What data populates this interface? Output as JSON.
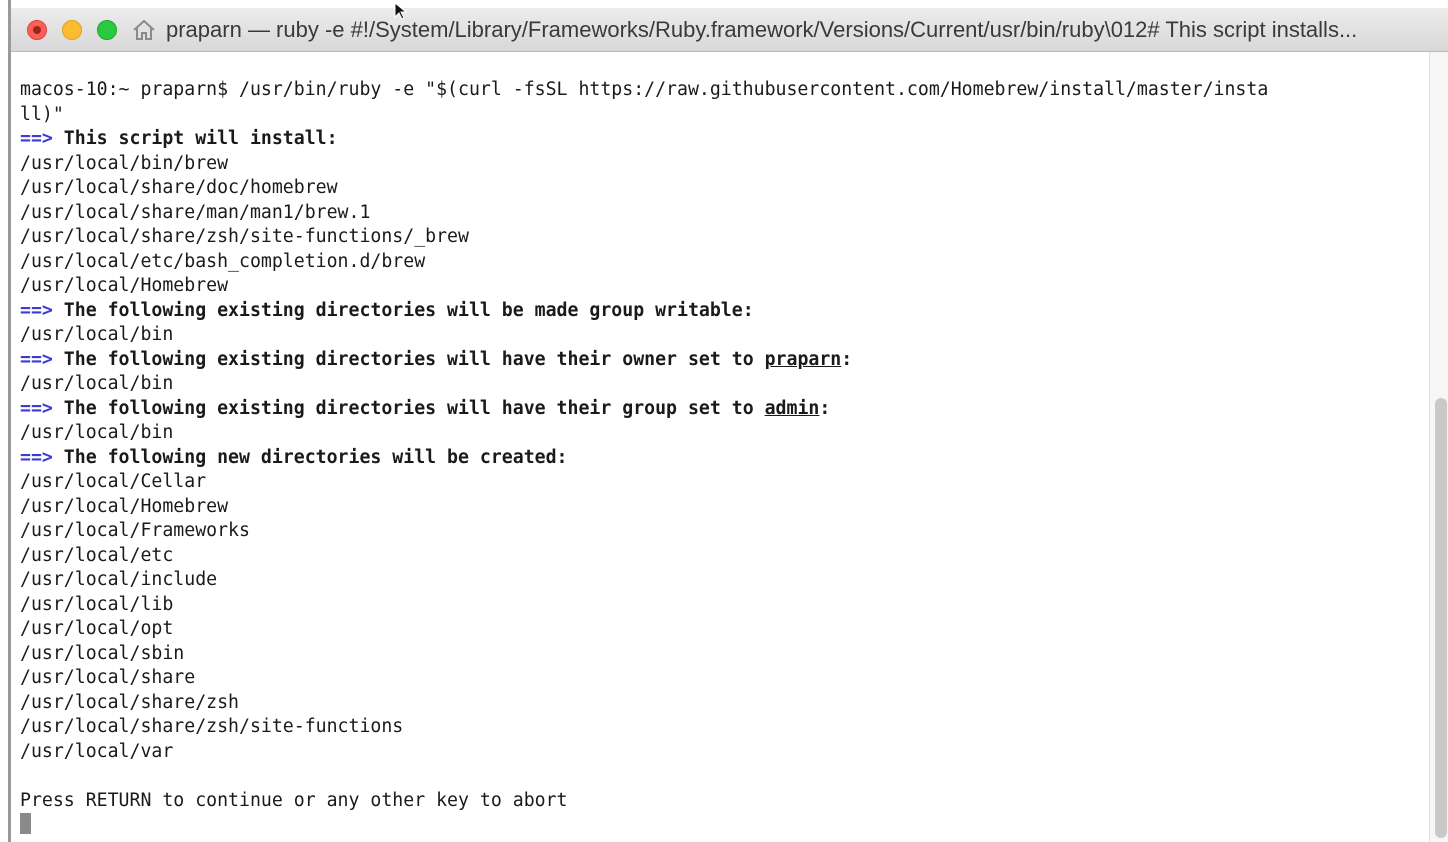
{
  "window": {
    "title": "praparn — ruby -e #!/System/Library/Frameworks/Ruby.framework/Versions/Current/usr/bin/ruby\\012# This script installs..."
  },
  "terminal": {
    "lines": [
      {
        "parts": [
          {
            "text": "macos-10:~ praparn$ /usr/bin/ruby -e \"$(curl -fsSL https://raw.githubusercontent.com/Homebrew/install/master/insta",
            "style": "plain"
          }
        ]
      },
      {
        "parts": [
          {
            "text": "ll)\"",
            "style": "plain"
          }
        ]
      },
      {
        "parts": [
          {
            "text": "==>",
            "style": "arrow"
          },
          {
            "text": " This script will install:",
            "style": "bold"
          }
        ]
      },
      {
        "parts": [
          {
            "text": "/usr/local/bin/brew",
            "style": "plain"
          }
        ]
      },
      {
        "parts": [
          {
            "text": "/usr/local/share/doc/homebrew",
            "style": "plain"
          }
        ]
      },
      {
        "parts": [
          {
            "text": "/usr/local/share/man/man1/brew.1",
            "style": "plain"
          }
        ]
      },
      {
        "parts": [
          {
            "text": "/usr/local/share/zsh/site-functions/_brew",
            "style": "plain"
          }
        ]
      },
      {
        "parts": [
          {
            "text": "/usr/local/etc/bash_completion.d/brew",
            "style": "plain"
          }
        ]
      },
      {
        "parts": [
          {
            "text": "/usr/local/Homebrew",
            "style": "plain"
          }
        ]
      },
      {
        "parts": [
          {
            "text": "==>",
            "style": "arrow"
          },
          {
            "text": " The following existing directories will be made group writable:",
            "style": "bold"
          }
        ]
      },
      {
        "parts": [
          {
            "text": "/usr/local/bin",
            "style": "plain"
          }
        ]
      },
      {
        "parts": [
          {
            "text": "==>",
            "style": "arrow"
          },
          {
            "text": " The following existing directories will have their owner set to ",
            "style": "bold"
          },
          {
            "text": "praparn",
            "style": "underline"
          },
          {
            "text": ":",
            "style": "bold"
          }
        ]
      },
      {
        "parts": [
          {
            "text": "/usr/local/bin",
            "style": "plain"
          }
        ]
      },
      {
        "parts": [
          {
            "text": "==>",
            "style": "arrow"
          },
          {
            "text": " The following existing directories will have their group set to ",
            "style": "bold"
          },
          {
            "text": "admin",
            "style": "underline"
          },
          {
            "text": ":",
            "style": "bold"
          }
        ]
      },
      {
        "parts": [
          {
            "text": "/usr/local/bin",
            "style": "plain"
          }
        ]
      },
      {
        "parts": [
          {
            "text": "==>",
            "style": "arrow"
          },
          {
            "text": " The following new directories will be created:",
            "style": "bold"
          }
        ]
      },
      {
        "parts": [
          {
            "text": "/usr/local/Cellar",
            "style": "plain"
          }
        ]
      },
      {
        "parts": [
          {
            "text": "/usr/local/Homebrew",
            "style": "plain"
          }
        ]
      },
      {
        "parts": [
          {
            "text": "/usr/local/Frameworks",
            "style": "plain"
          }
        ]
      },
      {
        "parts": [
          {
            "text": "/usr/local/etc",
            "style": "plain"
          }
        ]
      },
      {
        "parts": [
          {
            "text": "/usr/local/include",
            "style": "plain"
          }
        ]
      },
      {
        "parts": [
          {
            "text": "/usr/local/lib",
            "style": "plain"
          }
        ]
      },
      {
        "parts": [
          {
            "text": "/usr/local/opt",
            "style": "plain"
          }
        ]
      },
      {
        "parts": [
          {
            "text": "/usr/local/sbin",
            "style": "plain"
          }
        ]
      },
      {
        "parts": [
          {
            "text": "/usr/local/share",
            "style": "plain"
          }
        ]
      },
      {
        "parts": [
          {
            "text": "/usr/local/share/zsh",
            "style": "plain"
          }
        ]
      },
      {
        "parts": [
          {
            "text": "/usr/local/share/zsh/site-functions",
            "style": "plain"
          }
        ]
      },
      {
        "parts": [
          {
            "text": "/usr/local/var",
            "style": "plain"
          }
        ]
      },
      {
        "parts": [
          {
            "text": "",
            "style": "plain"
          }
        ]
      },
      {
        "parts": [
          {
            "text": "Press RETURN to continue or any other key to abort",
            "style": "plain"
          }
        ]
      },
      {
        "parts": [
          {
            "text": "",
            "style": "cursor"
          }
        ]
      }
    ]
  },
  "icons": {
    "close": "close-button-icon",
    "minimize": "minimize-button-icon",
    "zoom": "zoom-button-icon",
    "home": "home-icon",
    "pointer": "mouse-pointer-icon",
    "split": "split-pane-icon"
  },
  "colors": {
    "arrow": "#3b3bd6",
    "text": "#1a1a1a",
    "close": "#fc5f57",
    "minimize": "#fdbc2e",
    "zoom": "#29c940"
  }
}
